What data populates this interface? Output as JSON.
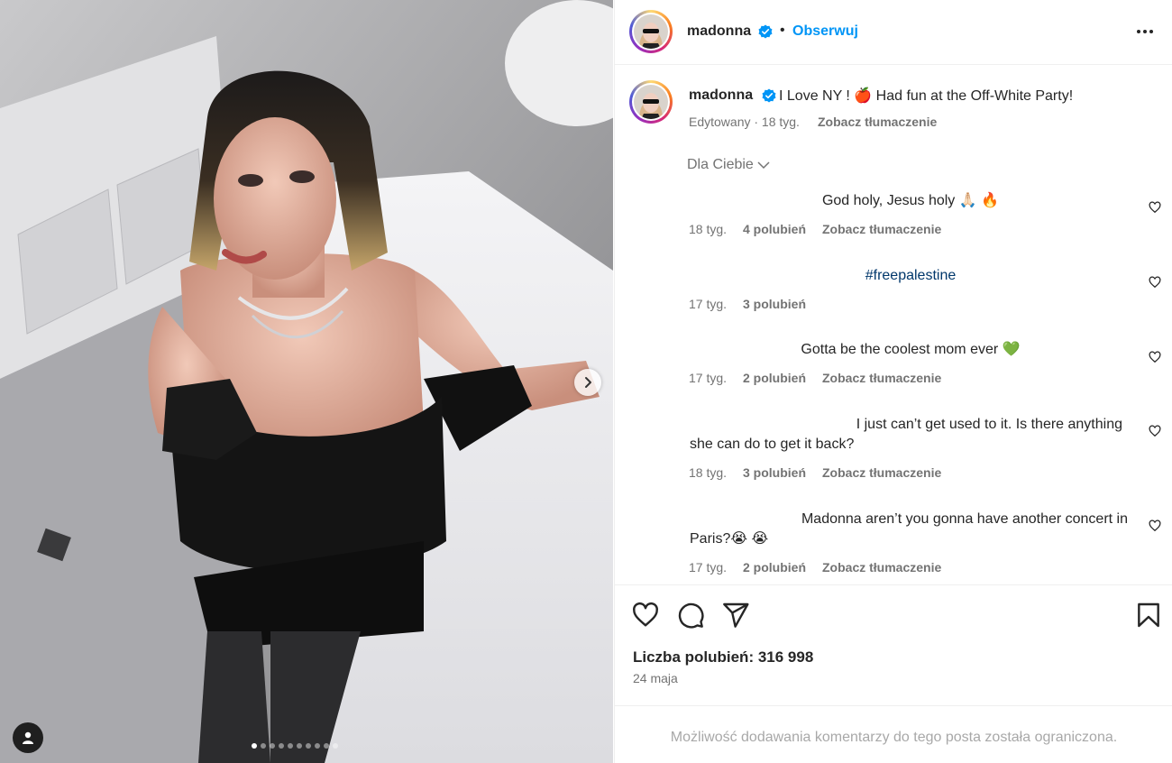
{
  "post": {
    "username": "madonna",
    "separator": "•",
    "follow_label": "Obserwuj",
    "more_icon": "more-options-icon"
  },
  "caption": {
    "username": "madonna",
    "text_part1": "I Love NY ! ",
    "emoji": "🍎",
    "text_part2": " Had fun at the Off-White Party!",
    "edited": "Edytowany · 18 tyg.",
    "translate": "Zobacz tłumaczenie"
  },
  "sort": {
    "label": "Dla Ciebie"
  },
  "comments": [
    {
      "text": "God holy, Jesus holy 🙏🏻 🔥",
      "age": "18 tyg.",
      "likes": "4 polubień",
      "translate": "Zobacz tłumaczenie"
    },
    {
      "text": "#freepalestine",
      "age": "17 tyg.",
      "likes": "3 polubień",
      "translate": ""
    },
    {
      "text": "Gotta be the coolest mom ever 💚",
      "age": "17 tyg.",
      "likes": "2 polubień",
      "translate": "Zobacz tłumaczenie"
    },
    {
      "text_line1": "I just can’t get used to it. Is there anything",
      "text_line2": "she can do to get it back?",
      "age": "18 tyg.",
      "likes": "3 polubień",
      "translate": "Zobacz tłumaczenie"
    },
    {
      "text_line1": "Madonna aren’t you gonna have another concert in",
      "text_line2": "Paris?😭 😭",
      "age": "17 tyg.",
      "likes": "2 polubień",
      "translate": "Zobacz tłumaczenie"
    }
  ],
  "stats": {
    "likes_label": "Liczba polubień: 316 998",
    "date": "24 maja"
  },
  "footer": {
    "note": "Możliwość dodawania komentarzy do tego posta została ograniczona."
  },
  "carousel": {
    "current": 1,
    "total": 10
  },
  "colors": {
    "accent": "#0095f6",
    "verified": "#0095f6",
    "muted": "#737373",
    "hashtag": "#00376b"
  }
}
